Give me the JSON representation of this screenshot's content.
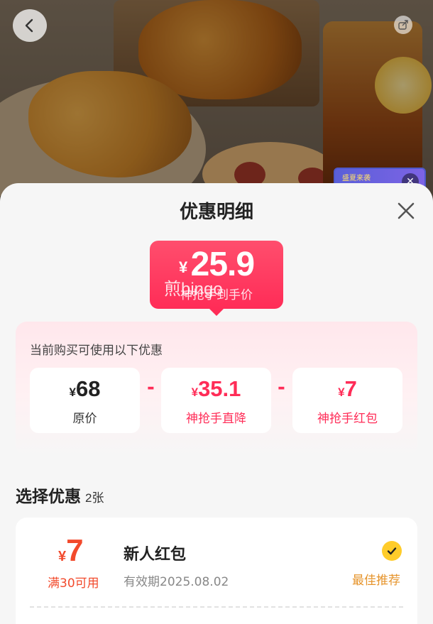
{
  "header": {
    "back_icon": "chevron-left-icon",
    "share_icon": "share-icon"
  },
  "promo": {
    "text": "盛夏来袭",
    "close_icon": "close-icon",
    "close_glyph": "✕"
  },
  "sheet": {
    "title": "优惠明细",
    "close_icon": "close-icon"
  },
  "price": {
    "currency": "¥",
    "value": "25.9",
    "label": "神抢手到手价",
    "overlay_text": "煎bingo"
  },
  "breakdown": {
    "hint": "当前购买可使用以下优惠",
    "minus": "-",
    "items": [
      {
        "currency": "¥",
        "value": "68",
        "label": "原价",
        "color": "#222222"
      },
      {
        "currency": "¥",
        "value": "35.1",
        "label": "神抢手直降",
        "color": "#ff2c57"
      },
      {
        "currency": "¥",
        "value": "7",
        "label": "神抢手红包",
        "color": "#ff2c57"
      }
    ]
  },
  "select": {
    "title": "选择优惠",
    "count": "2张"
  },
  "coupon": {
    "currency": "¥",
    "value": "7",
    "condition": "满30可用",
    "name": "新人红包",
    "expiry": "有效期2025.08.02",
    "badge": "最佳推荐",
    "checked": true,
    "check_icon": "checkmark-icon"
  },
  "colors": {
    "accent": "#ff2c57",
    "coupon_red": "#f24a2c",
    "best_orange": "#e6942b",
    "check_yellow": "#ffcc2a"
  }
}
